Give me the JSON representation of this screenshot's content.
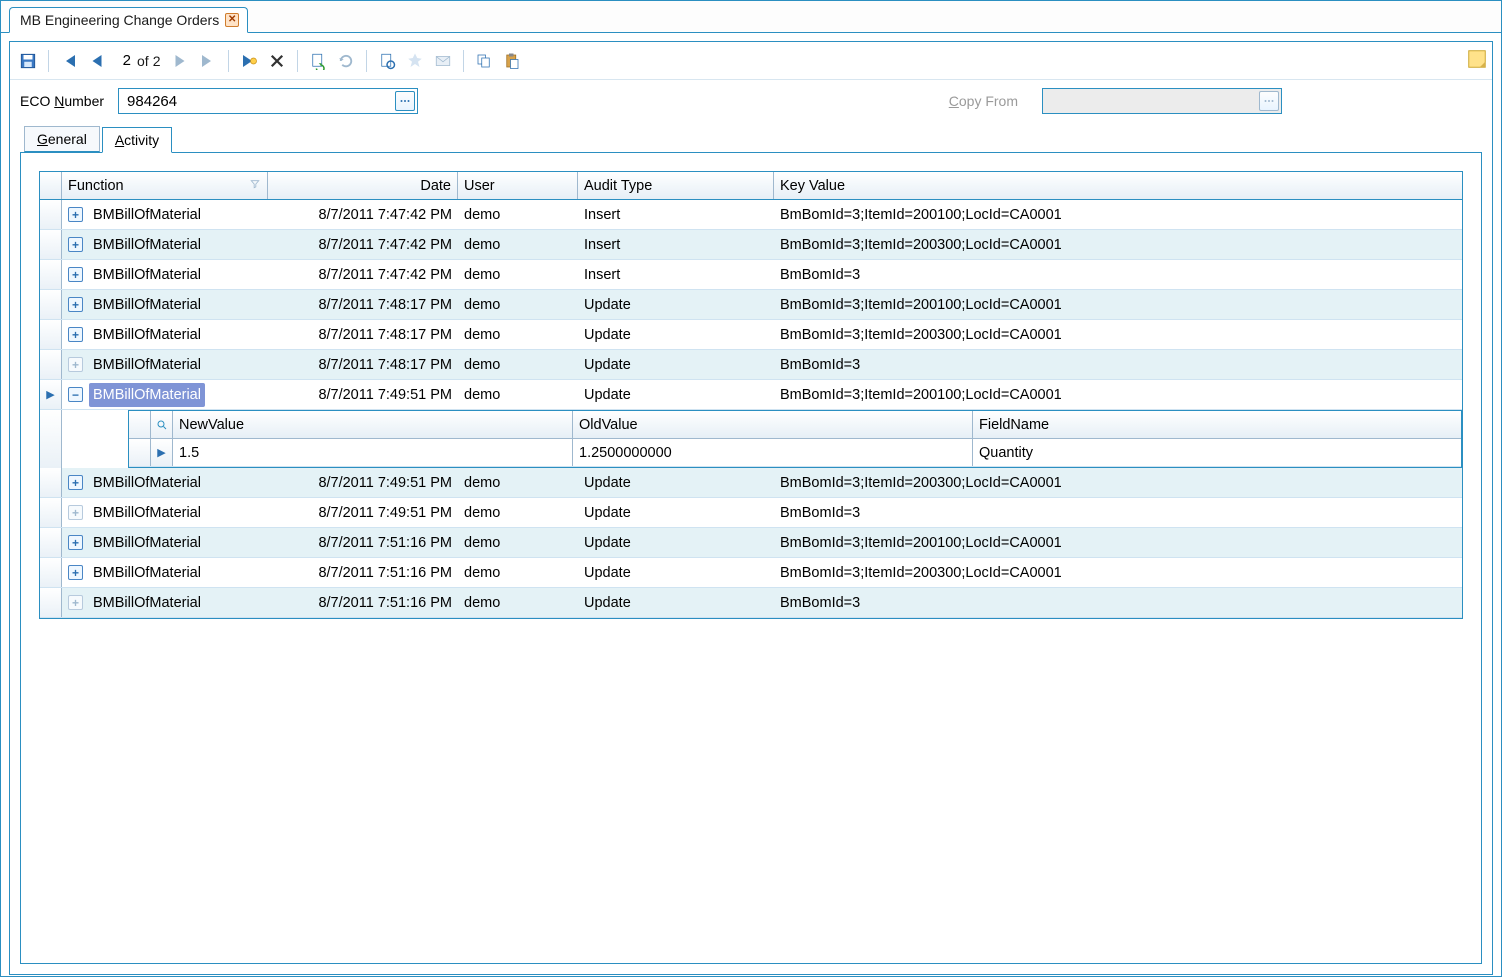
{
  "tab": {
    "title": "MB Engineering Change Orders"
  },
  "pager": {
    "current": "2",
    "of_label": " of ",
    "total": "2"
  },
  "form": {
    "eco_label_pre": "ECO ",
    "eco_label_u": "N",
    "eco_label_post": "umber",
    "eco_value": "984264",
    "copy_from_label": "Copy From",
    "copy_from_value": ""
  },
  "inner_tabs": {
    "general_u": "G",
    "general_rest": "eneral",
    "activity_u": "A",
    "activity_rest": "ctivity"
  },
  "grid": {
    "headers": {
      "function": "Function",
      "date": "Date",
      "user": "User",
      "audit_type": "Audit Type",
      "key_value": "Key Value"
    },
    "sub_headers": {
      "new_value": "NewValue",
      "old_value": "OldValue",
      "field_name": "FieldName"
    },
    "rows": [
      {
        "expand": "plus",
        "striped": false,
        "selected": false,
        "dim": false,
        "function": "BMBillOfMaterial",
        "date": "8/7/2011 7:47:42 PM",
        "user": "demo",
        "audit": "Insert",
        "key": "BmBomId=3;ItemId=200100;LocId=CA0001",
        "sub": null
      },
      {
        "expand": "plus",
        "striped": true,
        "selected": false,
        "dim": false,
        "function": "BMBillOfMaterial",
        "date": "8/7/2011 7:47:42 PM",
        "user": "demo",
        "audit": "Insert",
        "key": "BmBomId=3;ItemId=200300;LocId=CA0001",
        "sub": null
      },
      {
        "expand": "plus",
        "striped": false,
        "selected": false,
        "dim": false,
        "function": "BMBillOfMaterial",
        "date": "8/7/2011 7:47:42 PM",
        "user": "demo",
        "audit": "Insert",
        "key": "BmBomId=3",
        "sub": null
      },
      {
        "expand": "plus",
        "striped": true,
        "selected": false,
        "dim": false,
        "function": "BMBillOfMaterial",
        "date": "8/7/2011 7:48:17 PM",
        "user": "demo",
        "audit": "Update",
        "key": "BmBomId=3;ItemId=200100;LocId=CA0001",
        "sub": null
      },
      {
        "expand": "plus",
        "striped": false,
        "selected": false,
        "dim": false,
        "function": "BMBillOfMaterial",
        "date": "8/7/2011 7:48:17 PM",
        "user": "demo",
        "audit": "Update",
        "key": "BmBomId=3;ItemId=200300;LocId=CA0001",
        "sub": null
      },
      {
        "expand": "plus",
        "striped": true,
        "selected": false,
        "dim": true,
        "function": "BMBillOfMaterial",
        "date": "8/7/2011 7:48:17 PM",
        "user": "demo",
        "audit": "Update",
        "key": "BmBomId=3",
        "sub": null
      },
      {
        "expand": "minus",
        "striped": false,
        "selected": true,
        "dim": false,
        "function": "BMBillOfMaterial",
        "date": "8/7/2011 7:49:51 PM",
        "user": "demo",
        "audit": "Update",
        "key": "BmBomId=3;ItemId=200100;LocId=CA0001",
        "sub": {
          "new": "1.5",
          "old": "1.2500000000",
          "field": "Quantity"
        }
      },
      {
        "expand": "plus",
        "striped": true,
        "selected": false,
        "dim": false,
        "function": "BMBillOfMaterial",
        "date": "8/7/2011 7:49:51 PM",
        "user": "demo",
        "audit": "Update",
        "key": "BmBomId=3;ItemId=200300;LocId=CA0001",
        "sub": null
      },
      {
        "expand": "plus",
        "striped": false,
        "selected": false,
        "dim": true,
        "function": "BMBillOfMaterial",
        "date": "8/7/2011 7:49:51 PM",
        "user": "demo",
        "audit": "Update",
        "key": "BmBomId=3",
        "sub": null
      },
      {
        "expand": "plus",
        "striped": true,
        "selected": false,
        "dim": false,
        "function": "BMBillOfMaterial",
        "date": "8/7/2011 7:51:16 PM",
        "user": "demo",
        "audit": "Update",
        "key": "BmBomId=3;ItemId=200100;LocId=CA0001",
        "sub": null
      },
      {
        "expand": "plus",
        "striped": false,
        "selected": false,
        "dim": false,
        "function": "BMBillOfMaterial",
        "date": "8/7/2011 7:51:16 PM",
        "user": "demo",
        "audit": "Update",
        "key": "BmBomId=3;ItemId=200300;LocId=CA0001",
        "sub": null
      },
      {
        "expand": "plus",
        "striped": true,
        "selected": false,
        "dim": true,
        "function": "BMBillOfMaterial",
        "date": "8/7/2011 7:51:16 PM",
        "user": "demo",
        "audit": "Update",
        "key": "BmBomId=3",
        "sub": null
      }
    ]
  }
}
